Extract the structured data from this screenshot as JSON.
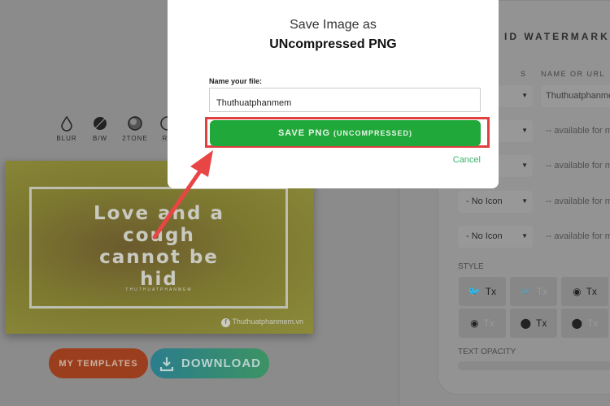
{
  "filters": [
    {
      "label": "BLUR",
      "icon": "droplet-icon"
    },
    {
      "label": "B/W",
      "icon": "bw-circle-icon"
    },
    {
      "label": "2TONE",
      "icon": "twotone-circle-icon"
    },
    {
      "label": "RE",
      "icon": "reset-icon"
    }
  ],
  "preview": {
    "quote": "Love and a cough cannot be hid",
    "small_text": "THUTHUATPHANMEM",
    "watermark": "Thuthuatphanmem.vn"
  },
  "buttons": {
    "my_templates": "MY TEMPLATES",
    "download": "DOWNLOAD"
  },
  "right_panel": {
    "header": "ID WATERMARK",
    "col_icon": "S",
    "col_name": "NAME OR URL",
    "rows": [
      {
        "icon": "",
        "name": "Thuthuatphanmem"
      },
      {
        "icon": "",
        "name": "-- available for m"
      },
      {
        "icon": "",
        "name": "-- available for m"
      },
      {
        "icon": "- No Icon",
        "name": "-- available for m"
      },
      {
        "icon": "- No Icon",
        "name": "-- available for m"
      }
    ],
    "style_label": "STYLE",
    "style_cells": [
      "Tx",
      "Tx",
      "Tx",
      "Tx",
      "Tx",
      "Tx"
    ],
    "text_opacity_label": "TEXT OPACITY"
  },
  "modal": {
    "title_line1": "Save Image as",
    "title_line2": "UNcompressed PNG",
    "file_label": "Name your file:",
    "file_value": "Thuthuatphanmem",
    "save_label": "SAVE PNG",
    "save_sub": "(UNCOMPRESSED)",
    "cancel": "Cancel"
  },
  "colors": {
    "save_green": "#20a83a",
    "highlight_red": "#e04040",
    "cancel_green": "#3bb56b"
  }
}
